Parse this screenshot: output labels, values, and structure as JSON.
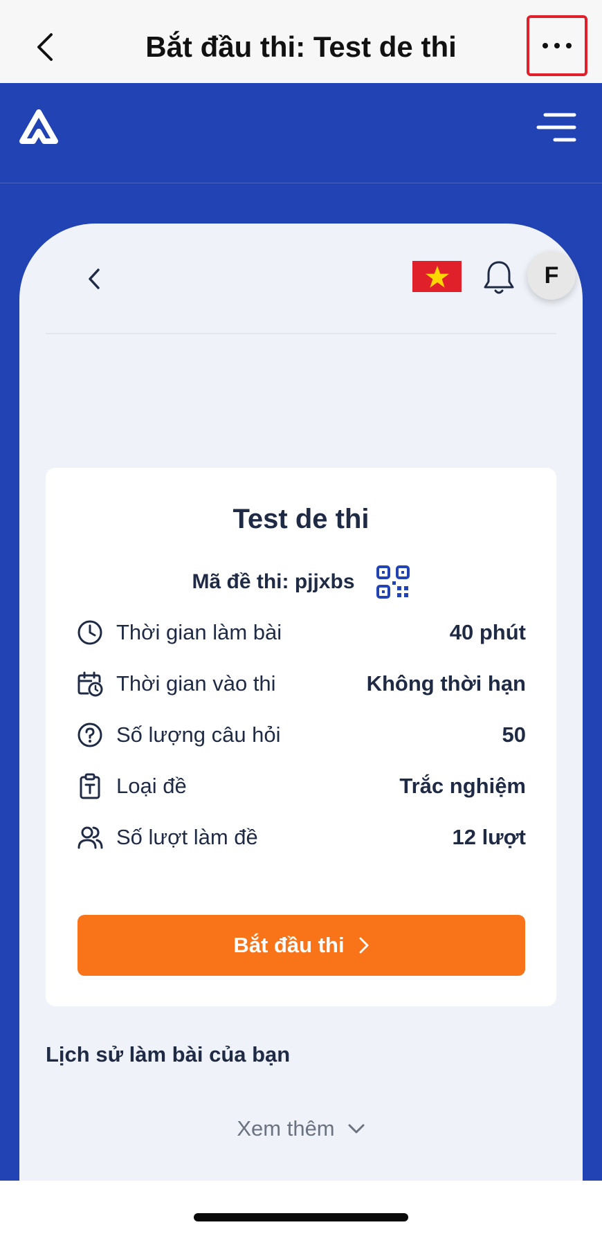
{
  "navbar": {
    "title": "Bắt đầu thi: Test de thi"
  },
  "header": {
    "flag": "vietnam-flag",
    "avatar_initial": "F"
  },
  "exam": {
    "title": "Test de thi",
    "code_label": "Mã đề thi: pjjxbs",
    "rows": [
      {
        "icon": "clock-icon",
        "label": "Thời gian làm bài",
        "value": "40 phút"
      },
      {
        "icon": "calendar-clock-icon",
        "label": "Thời gian vào thi",
        "value": "Không thời hạn"
      },
      {
        "icon": "question-circle-icon",
        "label": "Số lượng câu hỏi",
        "value": "50"
      },
      {
        "icon": "clipboard-text-icon",
        "label": "Loại đề",
        "value": "Trắc nghiệm"
      },
      {
        "icon": "users-icon",
        "label": "Số lượt làm đề",
        "value": "12 lượt"
      }
    ],
    "start_button": "Bắt đầu thi"
  },
  "history": {
    "title": "Lịch sử làm bài của bạn",
    "more_label": "Xem thêm"
  },
  "colors": {
    "brand_blue": "#2243b3",
    "accent_orange": "#f97319",
    "highlight_red": "#e0202a"
  }
}
